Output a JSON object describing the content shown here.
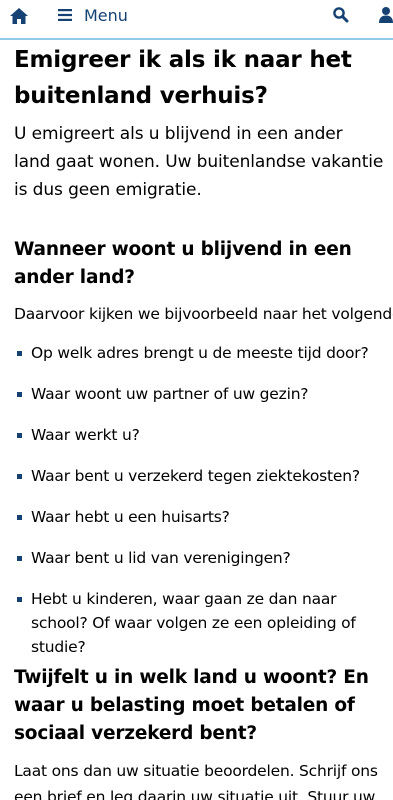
{
  "header": {
    "menu_label": "Menu",
    "icons": [
      "home-icon",
      "hamburger-icon",
      "search-icon",
      "user-icon"
    ],
    "accent_color": "#154273",
    "border_color": "#8fcae7"
  },
  "article": {
    "title": "Emigreer ik als ik naar het buitenland verhuis?",
    "intro": "U emigreert als u blijvend in een ander land gaat wonen. Uw buitenlandse vakantie is dus geen emigratie.",
    "section1_heading": "Wanneer woont u blijvend in een ander land?",
    "section1_lead": "Daarvoor kijken we bijvoorbeeld naar het volgende:",
    "section1_items": [
      "Op welk adres brengt u de meeste tijd door?",
      "Waar woont uw partner of uw gezin?",
      "Waar werkt u?",
      "Waar bent u verzekerd tegen ziektekosten?",
      "Waar hebt u een huisarts?",
      "Waar bent u lid van verenigingen?",
      "Hebt u kinderen, waar gaan ze dan naar school? Of waar volgen ze een opleiding of studie?"
    ],
    "section2_heading": "Twijfelt u in welk land u woont? En waar u belasting moet betalen of sociaal verzekerd bent?",
    "section2_text": "Laat ons dan uw situatie beoordelen. Schrijf ons een brief en leg daarin uw situatie uit. Stuur uw"
  }
}
